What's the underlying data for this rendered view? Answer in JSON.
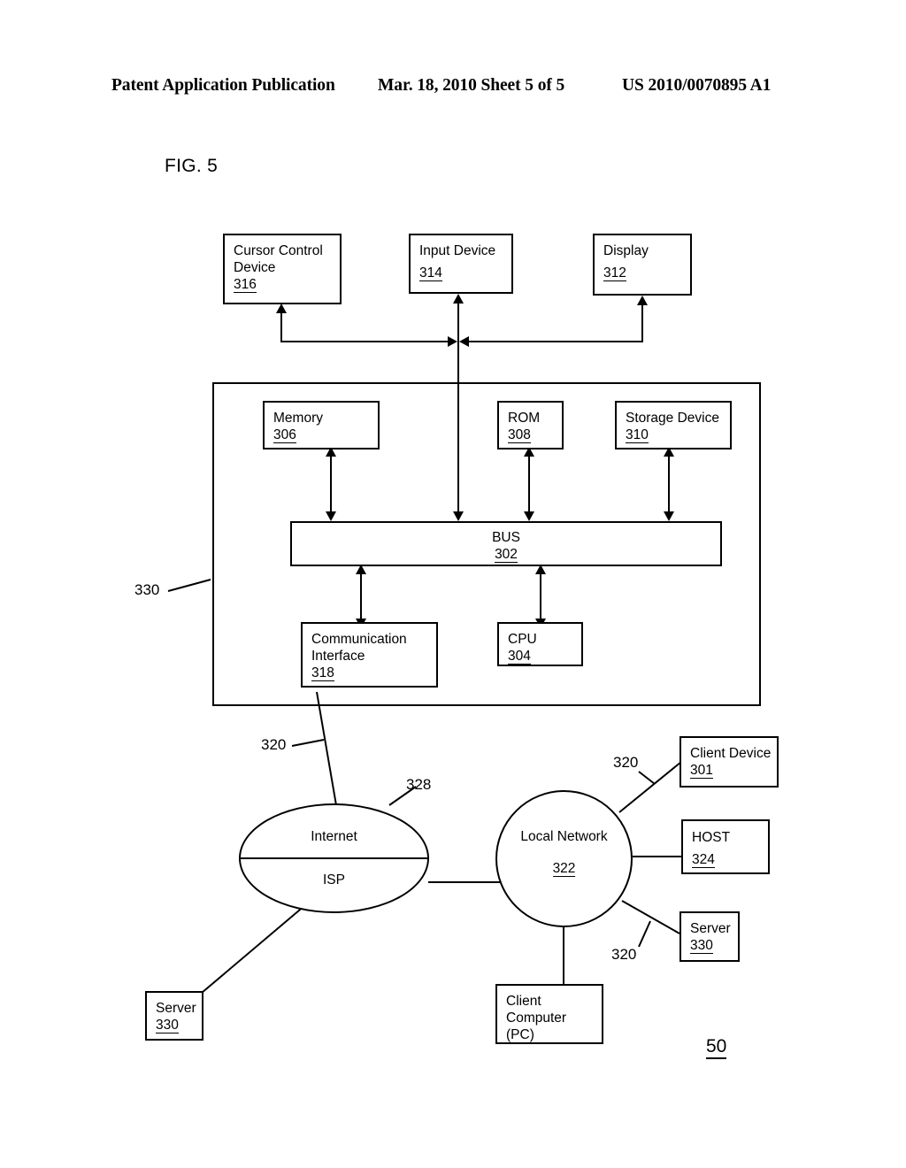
{
  "header": {
    "publication": "Patent Application Publication",
    "date_sheet": "Mar. 18, 2010  Sheet 5 of 5",
    "patent_number": "US 2010/0070895 A1"
  },
  "figure": {
    "label": "FIG. 5",
    "number": "50"
  },
  "peripherals": [
    {
      "title_line1": "Cursor Control",
      "title_line2": "Device",
      "ref": "316"
    },
    {
      "title_line1": "Input Device",
      "title_line2": "",
      "ref": "314"
    },
    {
      "title_line1": "Display",
      "title_line2": "",
      "ref": "312"
    }
  ],
  "system": {
    "enclosure_ref": "330",
    "memory": {
      "title": "Memory",
      "ref": "306"
    },
    "rom": {
      "title": "ROM",
      "ref": "308"
    },
    "storage": {
      "title": "Storage Device",
      "ref": "310"
    },
    "bus": {
      "title": "BUS",
      "ref": "302"
    },
    "comm_interface": {
      "title_line1": "Communication",
      "title_line2": "Interface",
      "ref": "318"
    },
    "cpu": {
      "title": "CPU",
      "ref": "304"
    }
  },
  "network": {
    "internet": {
      "label_top": "Internet",
      "label_bottom": "ISP",
      "ref": "328"
    },
    "local_network": {
      "title": "Local Network",
      "ref": "322"
    },
    "client_device": {
      "title": "Client Device",
      "ref": "301"
    },
    "host": {
      "title": "HOST",
      "ref": "324"
    },
    "server_right": {
      "title": "Server",
      "ref": "330"
    },
    "server_bottom": {
      "title": "Server",
      "ref": "330"
    },
    "client_computer": {
      "line1": "Client",
      "line2": "Computer",
      "line3": "(PC)"
    },
    "link_labels": {
      "comm_to_internet": "320",
      "lan_to_client_device": "320",
      "lan_to_server": "320"
    }
  },
  "colors": {
    "ink": "#000000",
    "paper": "#ffffff"
  }
}
